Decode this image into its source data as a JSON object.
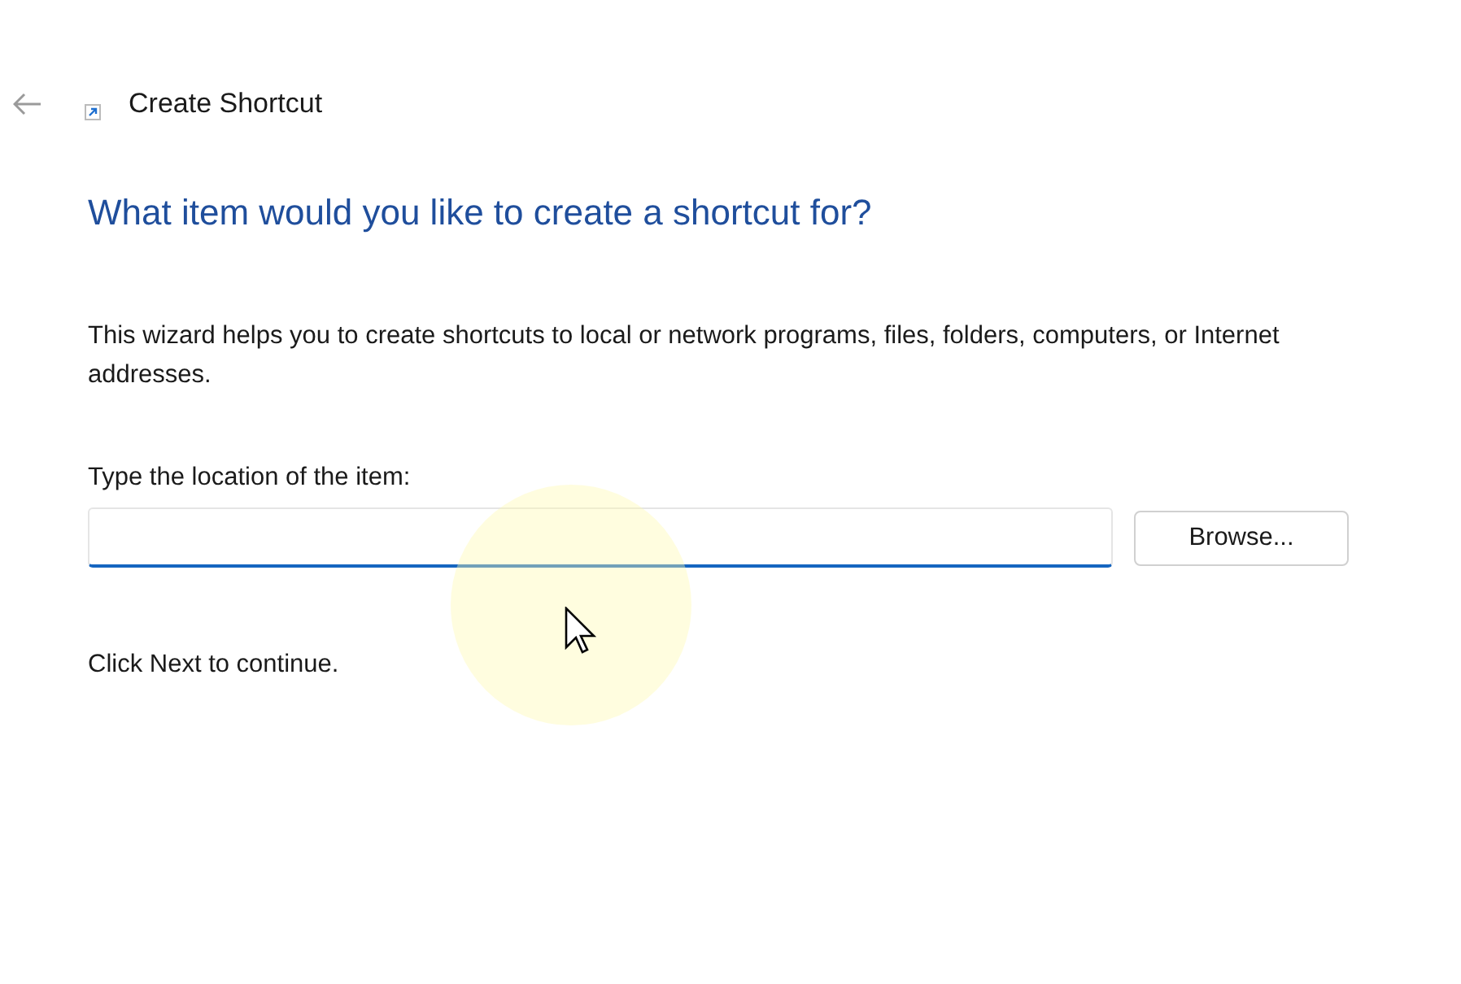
{
  "window": {
    "title": "Create Shortcut"
  },
  "heading": "What item would you like to create a shortcut for?",
  "description": "This wizard helps you to create shortcuts to local or network programs, files, folders, computers, or Internet addresses.",
  "location_field": {
    "label": "Type the location of the item:"
  },
  "browse_button": "Browse...",
  "hint": "Click Next to continue."
}
